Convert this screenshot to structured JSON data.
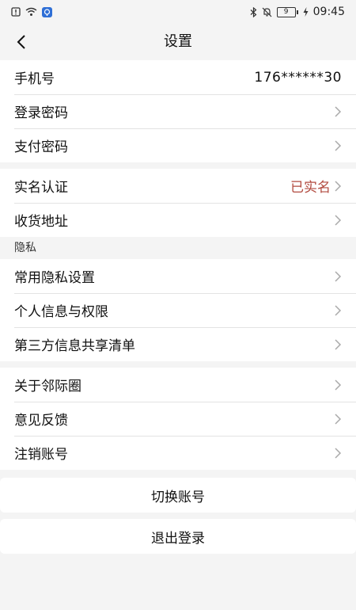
{
  "status_bar": {
    "left_icons": [
      "sim-alert-icon",
      "wifi-icon",
      "notification-app-icon"
    ],
    "right_icons": [
      "bluetooth-icon",
      "mute-bell-icon",
      "battery-icon",
      "charging-icon"
    ],
    "battery_level": "9",
    "time": "09:45"
  },
  "header": {
    "title": "设置"
  },
  "account": {
    "phone_label": "手机号",
    "phone_value": "176******30",
    "login_password_label": "登录密码",
    "pay_password_label": "支付密码"
  },
  "identity": {
    "realname_label": "实名认证",
    "realname_status": "已实名",
    "address_label": "收货地址"
  },
  "privacy": {
    "section_title": "隐私",
    "common_settings_label": "常用隐私设置",
    "personal_info_label": "个人信息与权限",
    "third_party_label": "第三方信息共享清单"
  },
  "about": {
    "about_label": "关于邻际圈",
    "feedback_label": "意见反馈",
    "cancel_account_label": "注销账号"
  },
  "actions": {
    "switch_account": "切换账号",
    "logout": "退出登录"
  },
  "colors": {
    "verified_text": "#b24a3f",
    "background": "#f4f4f4"
  }
}
